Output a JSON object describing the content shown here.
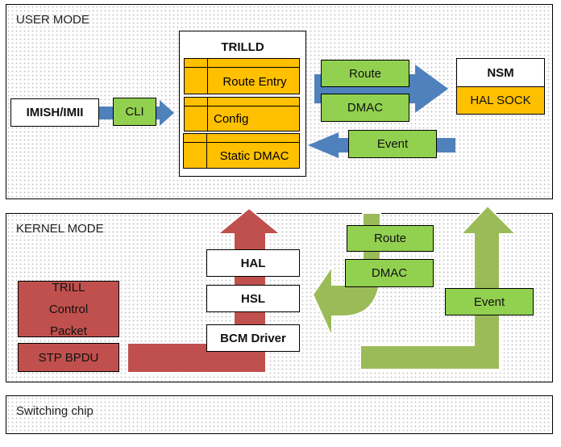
{
  "user_mode": {
    "label": "USER MODE",
    "imish": "IMISH/IMII",
    "cli": "CLI",
    "trilld": {
      "title": "TRILLD",
      "items": [
        "Route Entry",
        "Config",
        "Static DMAC"
      ]
    },
    "route": "Route",
    "dmac": "DMAC",
    "event": "Event",
    "nsm": "NSM",
    "hal_sock": "HAL SOCK"
  },
  "kernel_mode": {
    "label": "KERNEL MODE",
    "hal": "HAL",
    "hsl": "HSL",
    "bcm": "BCM Driver",
    "trill_control": "TRILL Control Packet",
    "stp": "STP BPDU",
    "route": "Route",
    "dmac": "DMAC",
    "event": "Event"
  },
  "switching": {
    "label": "Switching chip"
  },
  "colors": {
    "green": "#92d050",
    "orange": "#ffc000",
    "red": "#c0504d",
    "blue": "#4f81bd",
    "olive": "#9bbb59"
  }
}
